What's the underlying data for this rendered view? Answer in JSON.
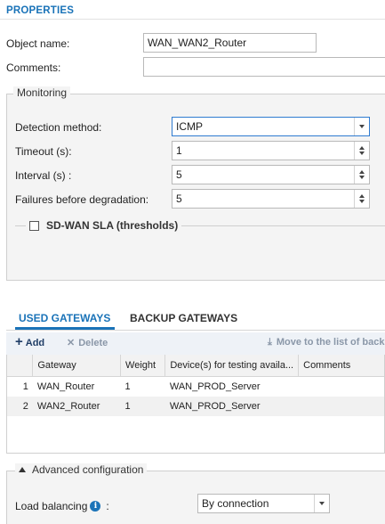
{
  "properties": {
    "title": "PROPERTIES",
    "object_name_label": "Object name:",
    "object_name_value": "WAN_WAN2_Router",
    "comments_label": "Comments:",
    "comments_value": ""
  },
  "monitoring": {
    "legend": "Monitoring",
    "detection_label": "Detection method:",
    "detection_value": "ICMP",
    "timeout_label": "Timeout (s):",
    "timeout_value": "1",
    "interval_label": "Interval (s) :",
    "interval_value": "5",
    "failures_label": "Failures before degradation:",
    "failures_value": "5",
    "sla_label": "SD-WAN SLA (thresholds)",
    "sla_checked": false
  },
  "tabs": [
    {
      "label": "USED GATEWAYS",
      "active": true
    },
    {
      "label": "BACKUP GATEWAYS",
      "active": false
    }
  ],
  "toolbar": {
    "add_label": "Add",
    "delete_label": "Delete",
    "move_label": "Move to the list of back"
  },
  "grid": {
    "columns": [
      "Gateway",
      "Weight",
      "Device(s) for testing availa...",
      "Comments"
    ],
    "rows": [
      {
        "num": "1",
        "gateway": "WAN_Router",
        "weight": "1",
        "device": "WAN_PROD_Server",
        "comments": ""
      },
      {
        "num": "2",
        "gateway": "WAN2_Router",
        "weight": "1",
        "device": "WAN_PROD_Server",
        "comments": ""
      }
    ]
  },
  "advanced": {
    "legend": "Advanced configuration",
    "load_balancing_label": "Load balancing",
    "load_balancing_suffix": ":",
    "load_balancing_value": "By connection"
  },
  "colors": {
    "accent": "#1a73b8",
    "panel_bg": "#f4f4f4",
    "toolbar_bg": "#eef2f7"
  },
  "icons": {
    "info": "info-icon",
    "add": "plus-icon",
    "delete": "x-icon",
    "move": "move-down-icon"
  }
}
